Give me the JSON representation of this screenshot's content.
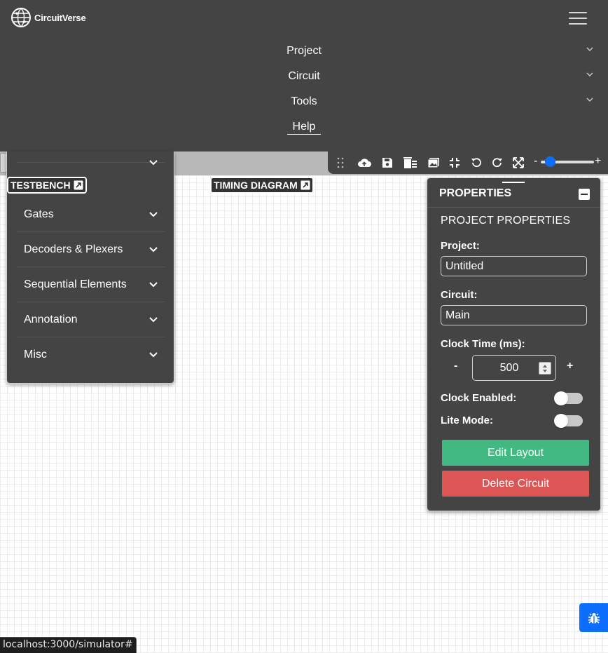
{
  "app": {
    "brand": "CircuitVerse"
  },
  "nav": {
    "items": [
      {
        "label": "Project"
      },
      {
        "label": "Circuit"
      },
      {
        "label": "Tools"
      },
      {
        "label": "Help"
      }
    ]
  },
  "toolbar": {
    "icons": [
      "drag-icon",
      "upload-cloud-icon",
      "save-icon",
      "delete-icon",
      "image-icon",
      "fit-icon",
      "undo-icon",
      "redo-icon",
      "fullscreen-icon"
    ],
    "zoom_minus": "-",
    "zoom_plus": "+",
    "zoom_level": 0.1
  },
  "badges": {
    "testbench": "TESTBENCH",
    "timing": "TIMING DIAGRAM"
  },
  "elements_panel": {
    "categories": [
      {
        "label": "Gates"
      },
      {
        "label": "Decoders & Plexers"
      },
      {
        "label": "Sequential Elements"
      },
      {
        "label": "Annotation"
      },
      {
        "label": "Misc"
      }
    ]
  },
  "properties": {
    "header": "PROPERTIES",
    "section_title": "PROJECT PROPERTIES",
    "project_label": "Project:",
    "project_value": "Untitled",
    "circuit_label": "Circuit:",
    "circuit_value": "Main",
    "clock_label": "Clock Time (ms):",
    "clock_minus": "-",
    "clock_plus": "+",
    "clock_value": "500",
    "clock_enabled_label": "Clock Enabled:",
    "clock_enabled": false,
    "lite_mode_label": "Lite Mode:",
    "lite_mode": false,
    "edit_layout": "Edit Layout",
    "delete_circuit": "Delete Circuit"
  },
  "colors": {
    "panel_bg": "#444444",
    "accent_blue": "#0d6efd",
    "edit_green": "#42b983",
    "delete_red": "#dc5656"
  },
  "status_bar": {
    "url": "localhost:3000/simulator#"
  }
}
